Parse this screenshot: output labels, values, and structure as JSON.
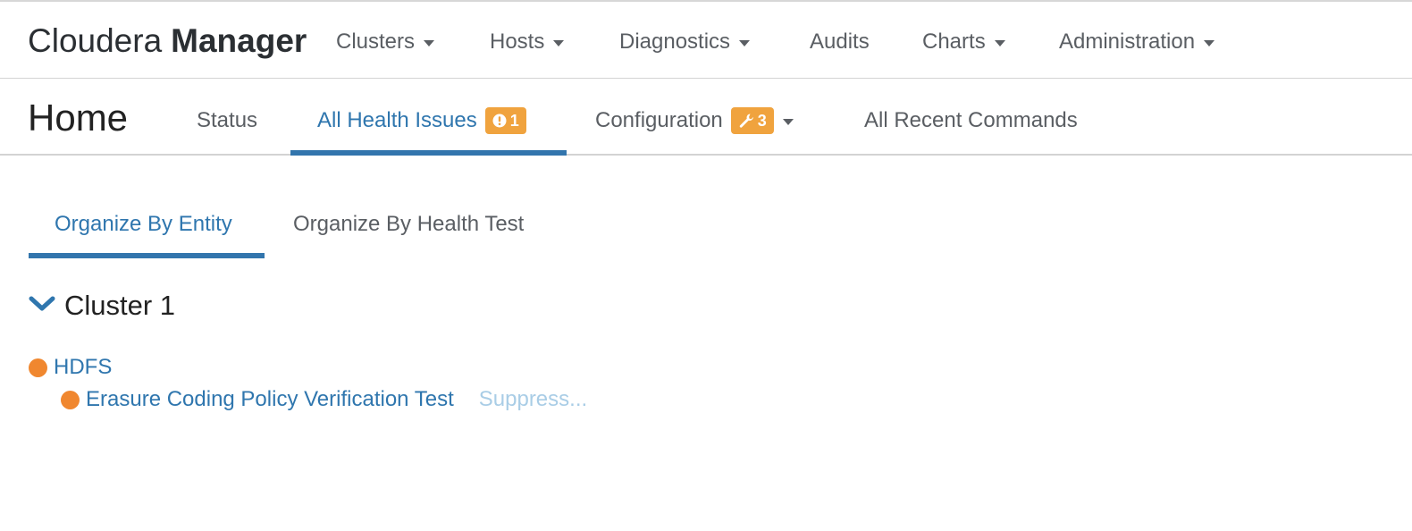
{
  "brand": {
    "light": "Cloudera",
    "bold": "Manager"
  },
  "nav": {
    "items": [
      {
        "label": "Clusters",
        "dropdown": true
      },
      {
        "label": "Hosts",
        "dropdown": true
      },
      {
        "label": "Diagnostics",
        "dropdown": true
      },
      {
        "label": "Audits",
        "dropdown": false
      },
      {
        "label": "Charts",
        "dropdown": true
      },
      {
        "label": "Administration",
        "dropdown": true
      }
    ]
  },
  "page": {
    "title": "Home"
  },
  "tabs": {
    "status": "Status",
    "health_issues": "All Health Issues",
    "health_issues_badge": "1",
    "configuration": "Configuration",
    "configuration_badge": "3",
    "recent_commands": "All Recent Commands"
  },
  "subtabs": {
    "by_entity": "Organize By Entity",
    "by_health_test": "Organize By Health Test"
  },
  "cluster": {
    "name": "Cluster 1",
    "service": "HDFS",
    "issue": "Erasure Coding Policy Verification Test",
    "suppress": "Suppress..."
  },
  "colors": {
    "accent": "#3275ad",
    "badge": "#f0a33e",
    "warning_dot": "#f0872f",
    "suppress": "#a9cde6"
  },
  "icons": {
    "health_badge": "exclamation-circle-icon",
    "config_badge": "wrench-icon",
    "cluster_toggle": "chevron-down-icon"
  }
}
